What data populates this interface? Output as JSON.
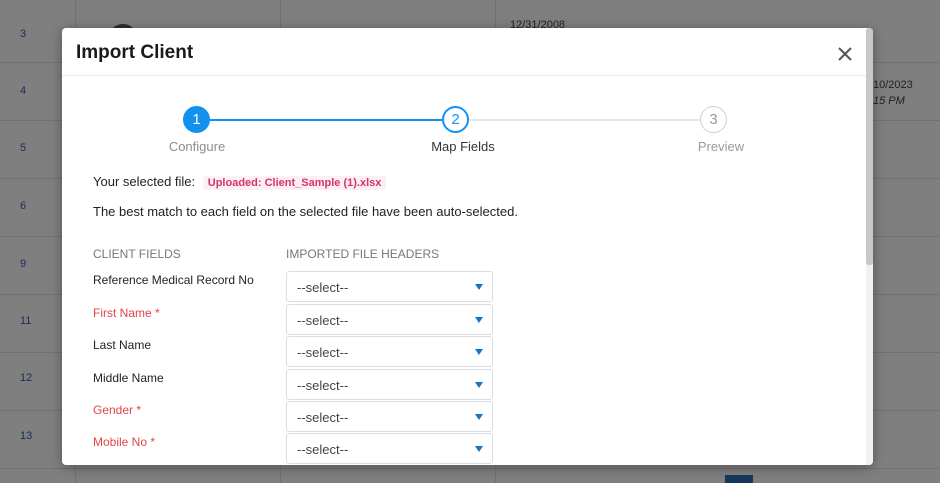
{
  "background": {
    "row_numbers": [
      "3",
      "4",
      "5",
      "6",
      "9",
      "11",
      "12",
      "13"
    ],
    "dates": [
      "12/31/2008",
      "10/2023"
    ],
    "times": [
      "15 PM"
    ]
  },
  "modal": {
    "title": "Import Client",
    "stepper": [
      {
        "number": "1",
        "label": "Configure",
        "state": "completed"
      },
      {
        "number": "2",
        "label": "Map Fields",
        "state": "active"
      },
      {
        "number": "3",
        "label": "Preview",
        "state": "pending"
      }
    ],
    "selected_file_label": "Your selected file:",
    "selected_file_value": "Uploaded: Client_Sample (1).xlsx",
    "auto_select_note": "The best match to each field on the selected file have been auto-selected.",
    "column_headers": {
      "client_fields": "CLIENT FIELDS",
      "imported_headers": "IMPORTED FILE HEADERS"
    },
    "fields": [
      {
        "label": "Reference Medical Record No",
        "required": false,
        "value": "--select--"
      },
      {
        "label": "First Name *",
        "required": true,
        "value": "--select--"
      },
      {
        "label": "Last Name",
        "required": false,
        "value": "--select--"
      },
      {
        "label": "Middle Name",
        "required": false,
        "value": "--select--"
      },
      {
        "label": "Gender *",
        "required": true,
        "value": "--select--"
      },
      {
        "label": "Mobile No *",
        "required": true,
        "value": "--select--"
      }
    ]
  },
  "colors": {
    "accent": "#1292ee",
    "required": "#e04545",
    "file_badge": "#d6336c"
  }
}
